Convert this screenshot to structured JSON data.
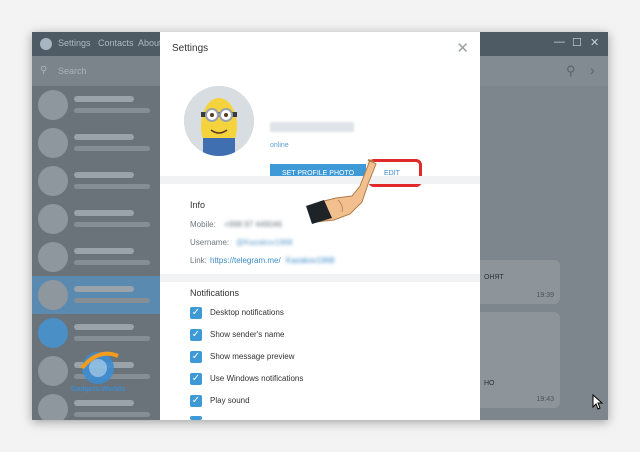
{
  "app": {
    "menu": [
      "Settings",
      "Contacts",
      "About"
    ],
    "search_placeholder": "Search",
    "window_controls": {
      "minimize": "—",
      "maximize": "☐",
      "close": "✕"
    }
  },
  "chats": [
    {
      "state": "normal"
    },
    {
      "state": "normal"
    },
    {
      "state": "normal"
    },
    {
      "state": "normal"
    },
    {
      "state": "normal"
    },
    {
      "state": "selected"
    },
    {
      "state": "normal"
    },
    {
      "state": "normal"
    },
    {
      "state": "normal"
    }
  ],
  "conversation": {
    "bubbles": [
      {
        "text": "ОНЯТ",
        "time": "19:39"
      },
      {
        "text": "НО",
        "time": "19:43"
      }
    ]
  },
  "settings": {
    "title": "Settings",
    "close_label": "✕",
    "profile": {
      "status": "online",
      "set_photo_label": "SET PROFILE PHOTO",
      "edit_label": "EDIT"
    },
    "info": {
      "title": "Info",
      "mobile_label": "Mobile:",
      "mobile_value": "+998 97 449046",
      "username_label": "Username:",
      "username_value": "@Kazakov1968",
      "link_label": "Link:",
      "link_prefix": "https://telegram.me/",
      "link_value": "Kazakov1968"
    },
    "notifications": {
      "title": "Notifications",
      "items": [
        {
          "label": "Desktop notifications",
          "checked": true
        },
        {
          "label": "Show sender's name",
          "checked": true
        },
        {
          "label": "Show message preview",
          "checked": true
        },
        {
          "label": "Use Windows notifications",
          "checked": true
        },
        {
          "label": "Play sound",
          "checked": true
        }
      ]
    }
  },
  "watermark": {
    "text": "Gadgets-Worlds"
  },
  "colors": {
    "accent": "#3d9ad6",
    "highlight": "#e02a2a",
    "link": "#3a8cc9"
  }
}
